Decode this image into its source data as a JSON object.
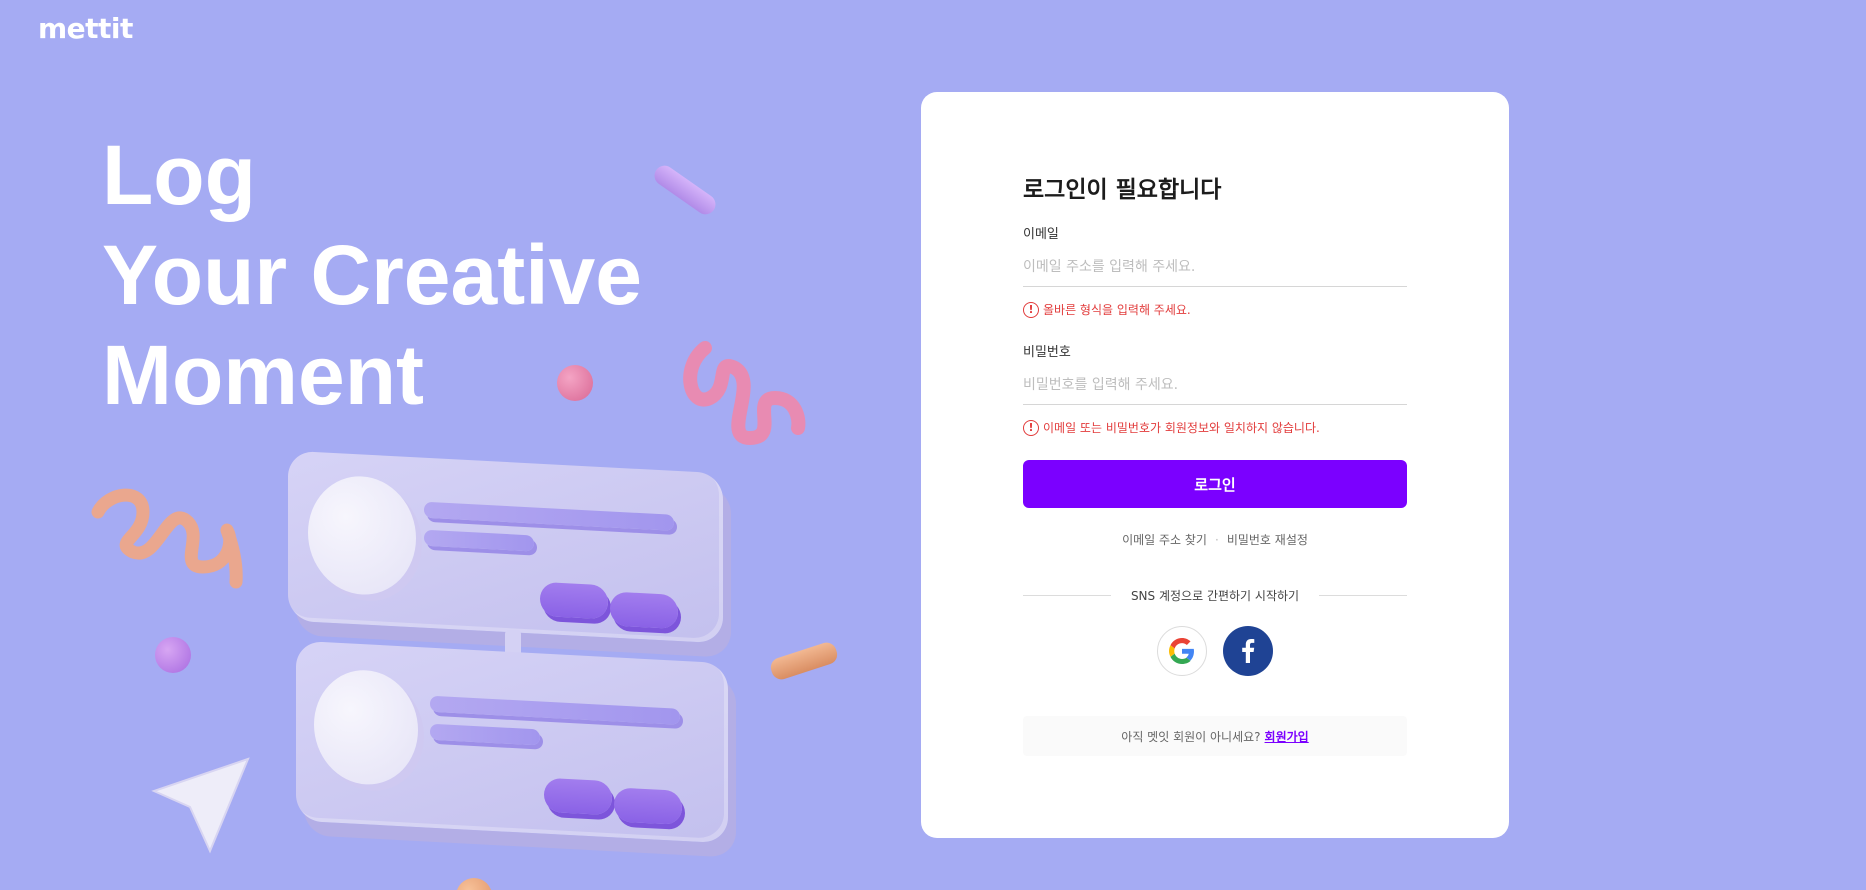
{
  "brand": {
    "logo": "mettit"
  },
  "hero": {
    "line1": "Log",
    "line2": "Your Creative",
    "line3": "Moment"
  },
  "login": {
    "title": "로그인이 필요합니다",
    "email": {
      "label": "이메일",
      "placeholder": "이메일 주소를 입력해 주세요.",
      "value": "",
      "error": "올바른 형식을 입력해 주세요."
    },
    "password": {
      "label": "비밀번호",
      "placeholder": "비밀번호를 입력해 주세요.",
      "value": "",
      "error": "이메일 또는 비밀번호가 회원정보와 일치하지 않습니다."
    },
    "submit_label": "로그인",
    "find_email": "이메일 주소 찾기",
    "reset_password": "비밀번호 재설정",
    "sns_divider": "SNS 계정으로 간편하기 시작하기",
    "sns": [
      {
        "name": "google",
        "icon": "google-icon"
      },
      {
        "name": "facebook",
        "icon": "facebook-icon"
      }
    ],
    "signup_prompt": "아직 멧잇 회원이 아니세요?",
    "signup_link": "회원가입"
  },
  "colors": {
    "background": "#a5abf3",
    "accent": "#7b00ff",
    "error": "#e23c3c",
    "facebook": "#1f4394"
  }
}
